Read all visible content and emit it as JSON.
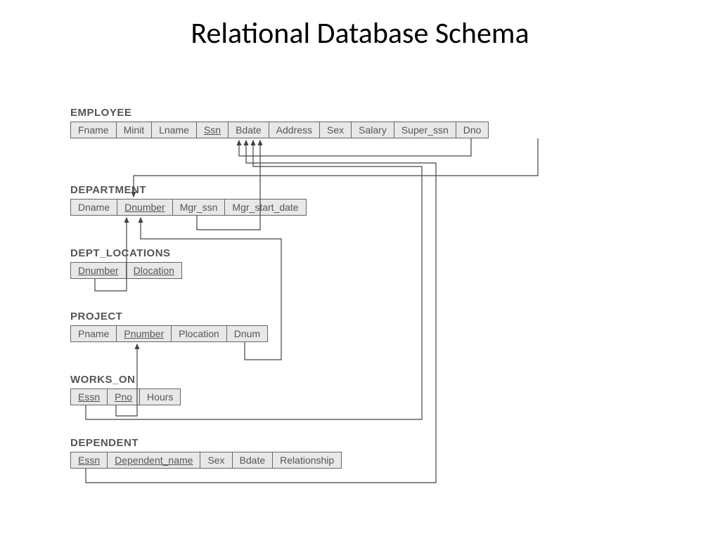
{
  "title": "Relational Database Schema",
  "tables": {
    "employee": {
      "name": "EMPLOYEE",
      "cols": {
        "fname": "Fname",
        "minit": "Minit",
        "lname": "Lname",
        "ssn": "Ssn",
        "bdate": "Bdate",
        "address": "Address",
        "sex": "Sex",
        "salary": "Salary",
        "super_ssn": "Super_ssn",
        "dno": "Dno"
      }
    },
    "department": {
      "name": "DEPARTMENT",
      "cols": {
        "dname": "Dname",
        "dnumber": "Dnumber",
        "mgr_ssn": "Mgr_ssn",
        "mgr_start_date": "Mgr_start_date"
      }
    },
    "dept_locations": {
      "name": "DEPT_LOCATIONS",
      "cols": {
        "dnumber": "Dnumber",
        "dlocation": "Dlocation"
      }
    },
    "project": {
      "name": "PROJECT",
      "cols": {
        "pname": "Pname",
        "pnumber": "Pnumber",
        "plocation": "Plocation",
        "dnum": "Dnum"
      }
    },
    "works_on": {
      "name": "WORKS_ON",
      "cols": {
        "essn": "Essn",
        "pno": "Pno",
        "hours": "Hours"
      }
    },
    "dependent": {
      "name": "DEPENDENT",
      "cols": {
        "essn": "Essn",
        "dependent_name": "Dependent_name",
        "sex": "Sex",
        "bdate": "Bdate",
        "relationship": "Relationship"
      }
    }
  }
}
